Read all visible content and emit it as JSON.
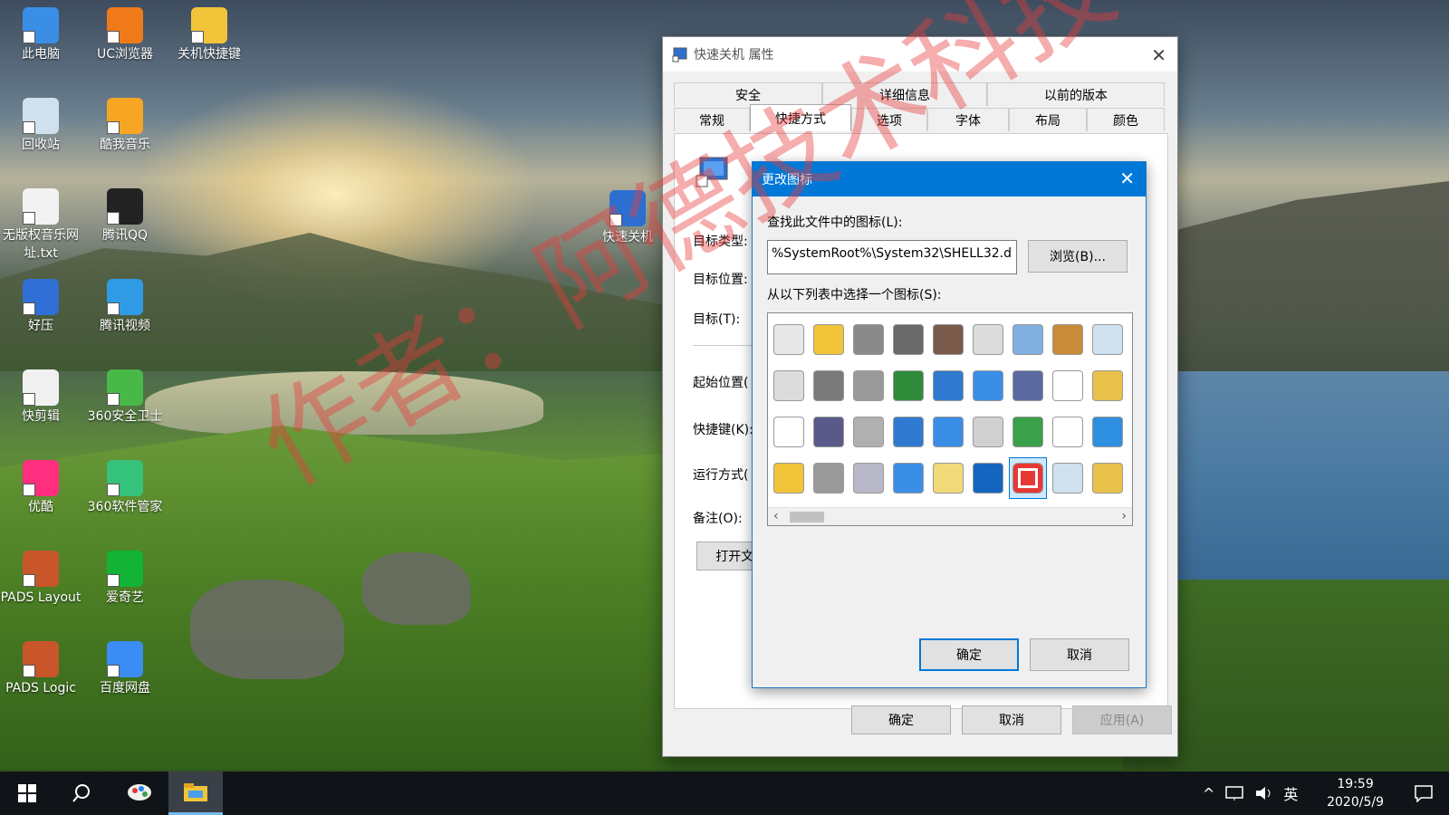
{
  "desktop": {
    "icons": [
      {
        "label": "此电脑",
        "color": "#3a8ee6"
      },
      {
        "label": "UC浏览器",
        "color": "#f07a1a"
      },
      {
        "label": "关机快捷键",
        "color": "#f2c43a"
      },
      {
        "label": "回收站",
        "color": "#cfe0ee"
      },
      {
        "label": "酷我音乐",
        "color": "#f6a623"
      },
      {
        "label": "无版权音乐网址.txt",
        "color": "#f2f2f2"
      },
      {
        "label": "腾讯QQ",
        "color": "#222222"
      },
      {
        "label": "好压",
        "color": "#2f6fd6"
      },
      {
        "label": "腾讯视频",
        "color": "#2f9be6"
      },
      {
        "label": "快剪辑",
        "color": "#f0f0f0"
      },
      {
        "label": "360安全卫士",
        "color": "#48b848"
      },
      {
        "label": "优酷",
        "color": "#ff2e7e"
      },
      {
        "label": "360软件管家",
        "color": "#35c27a"
      },
      {
        "label": "PADS Layout",
        "color": "#c8562a"
      },
      {
        "label": "爱奇艺",
        "color": "#12b336"
      },
      {
        "label": "PADS Logic",
        "color": "#c8562a"
      },
      {
        "label": "百度网盘",
        "color": "#3b8cf5"
      },
      {
        "label": "快速关机",
        "color": "#2d6fd0"
      }
    ]
  },
  "watermark": "作者：阿德技术科技",
  "properties_dialog": {
    "title": "快速关机 属性",
    "tabs_row1": [
      "安全",
      "详细信息",
      "以前的版本"
    ],
    "tabs_row2": [
      "常规",
      "快捷方式",
      "选项",
      "字体",
      "布局",
      "颜色"
    ],
    "fields": {
      "target_type": "目标类型:",
      "target_location": "目标位置:",
      "target": "目标(T):",
      "start_in": "起始位置(",
      "shortcut_key": "快捷键(K):",
      "run": "运行方式(",
      "comment": "备注(O):"
    },
    "open_file_button": "打开文(",
    "buttons": {
      "ok": "确定",
      "cancel": "取消",
      "apply": "应用(A)"
    }
  },
  "change_icon_dialog": {
    "title": "更改图标",
    "file_label": "查找此文件中的图标(L):",
    "file_value": "%SystemRoot%\\System32\\SHELL32.d",
    "browse_button": "浏览(B)...",
    "list_label": "从以下列表中选择一个图标(S):",
    "icon_colors": [
      "#e8e8e8",
      "#f2c43a",
      "#8a8a8a",
      "#6a6a6a",
      "#7a5a4a",
      "#dcdcdc",
      "#7fb0e0",
      "#c98a3a",
      "#cfe0ee",
      "#dcdcdc",
      "#7a7a7a",
      "#9a9a9a",
      "#2f8a3a",
      "#2f7ad0",
      "#3a8ee6",
      "#5a6aa0",
      "#ffffff",
      "#e8c24a",
      "#ffffff",
      "#5a5a8a",
      "#b0b0b0",
      "#2f7ad0",
      "#3a8ee6",
      "#d0d0d0",
      "#3aa04a",
      "#ffffff",
      "#2f8fe0",
      "#f2c43a",
      "#9a9a9a",
      "#b8b8c8",
      "#3a8ee6",
      "#f2d97a",
      "#1565c0",
      "#e53935",
      "#cfe0ee",
      "#e8c24a"
    ],
    "selected_index": 33,
    "buttons": {
      "ok": "确定",
      "cancel": "取消"
    }
  },
  "taskbar": {
    "clock_time": "19:59",
    "clock_date": "2020/5/9",
    "ime": "英"
  }
}
